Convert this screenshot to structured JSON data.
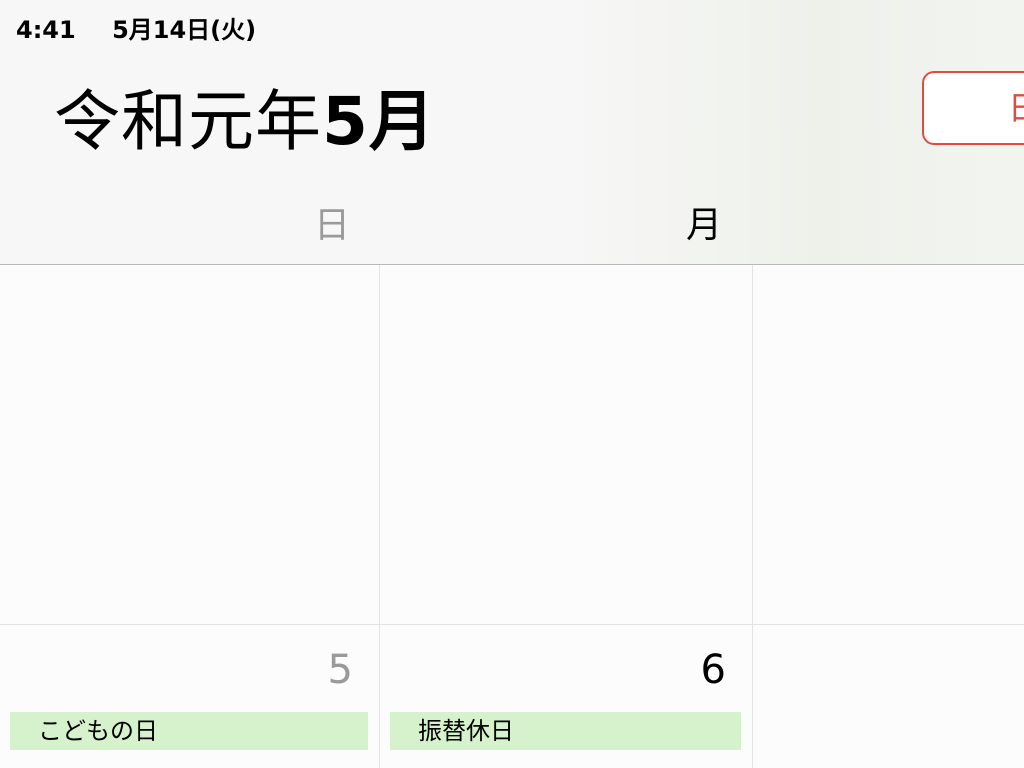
{
  "status_bar": {
    "time": "4:41",
    "date": "5月14日(火)"
  },
  "header": {
    "title_era": "令和元年",
    "title_month": "5月",
    "today_button_label": "日"
  },
  "weekdays": {
    "sunday": "日",
    "monday": "月"
  },
  "calendar": {
    "week2": {
      "sunday": {
        "day": "5",
        "event": "こどもの日"
      },
      "monday": {
        "day": "6",
        "event": "振替休日"
      }
    }
  },
  "colors": {
    "accent": "#e64a3f",
    "event_bg": "#d5f2cc",
    "sunday_text": "#9a9a9a"
  }
}
